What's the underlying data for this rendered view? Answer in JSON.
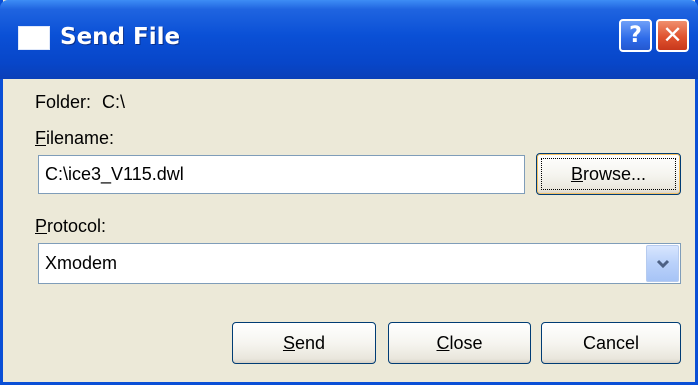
{
  "window": {
    "title": "Send File",
    "help_button": "?",
    "close_button": "✕"
  },
  "folder": {
    "label": "Folder:",
    "value": "C:\\"
  },
  "filename": {
    "label_accel": "F",
    "label_rest": "ilename:",
    "value": "C:\\ice3_V115.dwl",
    "browse_accel": "B",
    "browse_rest": "rowse..."
  },
  "protocol": {
    "label_accel": "P",
    "label_rest": "rotocol:",
    "selected": "Xmodem"
  },
  "buttons": {
    "send_accel": "S",
    "send_rest": "end",
    "close_accel": "C",
    "close_rest": "lose",
    "cancel": "Cancel"
  },
  "colors": {
    "title_bar": "#0a50d6",
    "dialog_background": "#ece9d8",
    "close_button": "#e0532f"
  },
  "icons": {
    "window_icon": "window-app-icon",
    "help": "help-icon",
    "close": "close-icon",
    "dropdown": "chevron-down-icon"
  }
}
